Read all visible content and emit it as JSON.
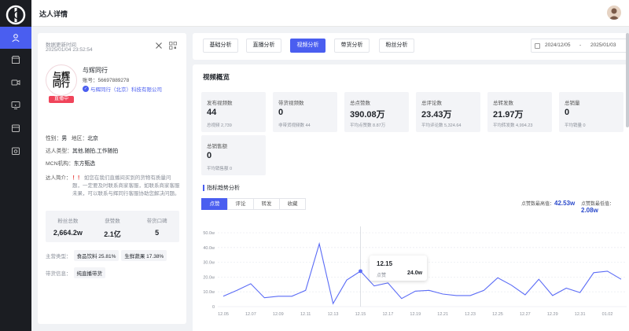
{
  "header": {
    "title": "达人详情"
  },
  "sidebar": {
    "items": [
      {
        "name": "user-icon",
        "active": true
      },
      {
        "name": "store-icon",
        "active": false
      },
      {
        "name": "video-icon",
        "active": false
      },
      {
        "name": "monitor-icon",
        "active": false
      },
      {
        "name": "shop-icon",
        "active": false
      },
      {
        "name": "bag-icon",
        "active": false
      }
    ]
  },
  "profile": {
    "update_label": "数据更新时间",
    "update_time": "2025/01/04 23:52:54",
    "name": "与辉同行",
    "account": "账号：56697889278",
    "company": "与辉同行（北京）科技有限公司",
    "live_badge": "直播中",
    "gender_label": "性别：",
    "gender": "男",
    "region_label": "地区：",
    "region": "北京",
    "type_label": "达人类型：",
    "type": "其他,随拍,工作随拍",
    "mcn_label": "MCN机构：",
    "mcn": "东方甄选",
    "intro_label": "达人简介：",
    "intro_mark": "！！",
    "intro": "如您在我们直播间买到的货物有质量问题，一定要及时联系商家客服，如联系商家客服未果，可以联系与辉同行客服协助您解决问题。",
    "stats": [
      {
        "label": "粉丝总数",
        "value": "2,664.2w"
      },
      {
        "label": "获赞数",
        "value": "2.1亿"
      },
      {
        "label": "带货口碑",
        "value": "5"
      }
    ],
    "category_label": "主营类型：",
    "categories": [
      "食品饮料 25.81%",
      "生鲜蔬果 17.38%"
    ],
    "goods_label": "带货信息：",
    "goods": "纯直播带货"
  },
  "tabs": [
    {
      "label": "基础分析"
    },
    {
      "label": "直播分析"
    },
    {
      "label": "视频分析",
      "active": true
    },
    {
      "label": "带货分析"
    },
    {
      "label": "粉丝分析"
    }
  ],
  "date_range": {
    "start": "2024/12/05",
    "sep": "-",
    "end": "2025/01/03"
  },
  "overview": {
    "title": "视频概览",
    "cards": [
      {
        "label": "发布视频数",
        "value": "44",
        "sub": "总视频 2,739"
      },
      {
        "label": "带货视频数",
        "value": "0",
        "sub": "非带货视频数 44"
      },
      {
        "label": "总点赞数",
        "value": "390.08万",
        "sub": "平均点赞数 8.87万"
      },
      {
        "label": "总评论数",
        "value": "23.43万",
        "sub": "平均评论数 5,324.64"
      },
      {
        "label": "总转发数",
        "value": "21.97万",
        "sub": "平均转发数 4,994.23"
      },
      {
        "label": "总销量",
        "value": "0",
        "sub": "平均销量 0"
      },
      {
        "label": "总销售额",
        "value": "0",
        "sub": "平均销售额 0"
      }
    ]
  },
  "trend": {
    "title": "指标趋势分析",
    "metric_tabs": [
      "点赞",
      "评论",
      "转发",
      "收藏"
    ],
    "max_label": "点赞数最高值：",
    "max_value": "42.53w",
    "min_label": "点赞数最低值：",
    "min_value": "2.08w",
    "tooltip": {
      "date": "12.15",
      "metric": "点赞",
      "value": "24.0w"
    }
  },
  "chart_data": {
    "type": "line",
    "y_ticks": [
      "50.0w",
      "40.0w",
      "30.0w",
      "20.0w",
      "10.0w",
      "0"
    ],
    "ylim": [
      0,
      50
    ],
    "x_ticks": [
      "12.05",
      "12.07",
      "12.09",
      "12.11",
      "12.13",
      "12.15",
      "12.17",
      "12.19",
      "12.21",
      "12.23",
      "12.25",
      "12.27",
      "12.29",
      "12.31",
      "01.02"
    ],
    "series": [
      {
        "values": [
          7,
          11,
          15.5,
          6,
          7,
          7,
          11,
          42.5,
          2.1,
          18,
          24,
          14,
          16,
          5.5,
          10.5,
          11,
          8.5,
          7.5,
          7.5,
          11,
          19.5,
          14.5,
          8,
          18.5,
          7.5,
          12.5,
          9.5,
          23,
          24,
          18.5
        ]
      }
    ],
    "highlight_index": 10,
    "colors": {
      "line": "#5b6cf6"
    }
  }
}
